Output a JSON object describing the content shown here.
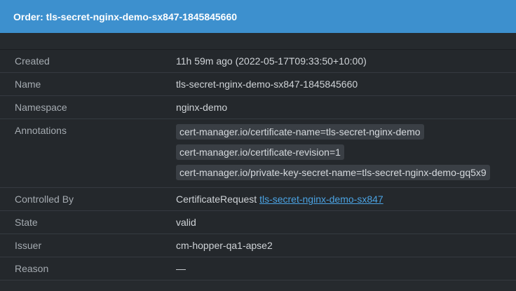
{
  "header": {
    "title": "Order: tls-secret-nginx-demo-sx847-1845845660"
  },
  "details": {
    "created_label": "Created",
    "created_value": "11h 59m ago (2022-05-17T09:33:50+10:00)",
    "name_label": "Name",
    "name_value": "tls-secret-nginx-demo-sx847-1845845660",
    "namespace_label": "Namespace",
    "namespace_value": "nginx-demo",
    "annotations_label": "Annotations",
    "annotations": [
      "cert-manager.io/certificate-name=tls-secret-nginx-demo",
      "cert-manager.io/certificate-revision=1",
      "cert-manager.io/private-key-secret-name=tls-secret-nginx-demo-gq5x9"
    ],
    "controlled_by_label": "Controlled By",
    "controlled_by_kind": "CertificateRequest",
    "controlled_by_link": "tls-secret-nginx-demo-sx847",
    "state_label": "State",
    "state_value": "valid",
    "issuer_label": "Issuer",
    "issuer_value": "cm-hopper-qa1-apse2",
    "reason_label": "Reason",
    "reason_value": "—"
  }
}
